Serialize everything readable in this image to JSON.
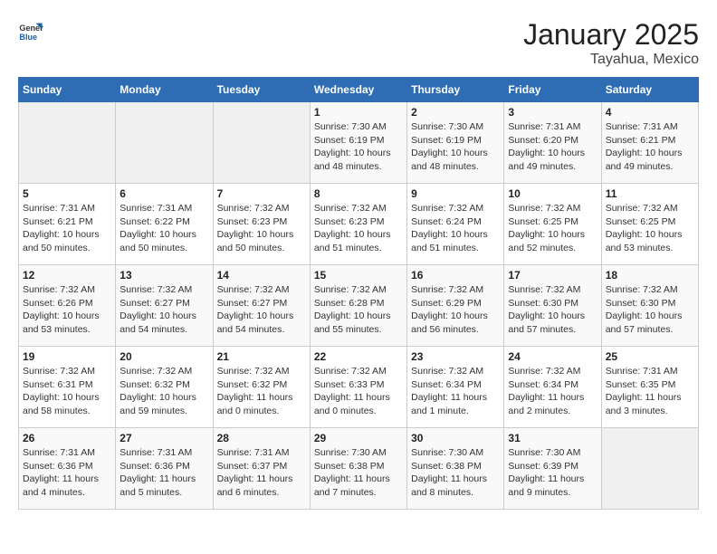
{
  "logo": {
    "text_general": "General",
    "text_blue": "Blue"
  },
  "title": "January 2025",
  "subtitle": "Tayahua, Mexico",
  "days_header": [
    "Sunday",
    "Monday",
    "Tuesday",
    "Wednesday",
    "Thursday",
    "Friday",
    "Saturday"
  ],
  "weeks": [
    [
      {
        "day": "",
        "info": ""
      },
      {
        "day": "",
        "info": ""
      },
      {
        "day": "",
        "info": ""
      },
      {
        "day": "1",
        "info": "Sunrise: 7:30 AM\nSunset: 6:19 PM\nDaylight: 10 hours\nand 48 minutes."
      },
      {
        "day": "2",
        "info": "Sunrise: 7:30 AM\nSunset: 6:19 PM\nDaylight: 10 hours\nand 48 minutes."
      },
      {
        "day": "3",
        "info": "Sunrise: 7:31 AM\nSunset: 6:20 PM\nDaylight: 10 hours\nand 49 minutes."
      },
      {
        "day": "4",
        "info": "Sunrise: 7:31 AM\nSunset: 6:21 PM\nDaylight: 10 hours\nand 49 minutes."
      }
    ],
    [
      {
        "day": "5",
        "info": "Sunrise: 7:31 AM\nSunset: 6:21 PM\nDaylight: 10 hours\nand 50 minutes."
      },
      {
        "day": "6",
        "info": "Sunrise: 7:31 AM\nSunset: 6:22 PM\nDaylight: 10 hours\nand 50 minutes."
      },
      {
        "day": "7",
        "info": "Sunrise: 7:32 AM\nSunset: 6:23 PM\nDaylight: 10 hours\nand 50 minutes."
      },
      {
        "day": "8",
        "info": "Sunrise: 7:32 AM\nSunset: 6:23 PM\nDaylight: 10 hours\nand 51 minutes."
      },
      {
        "day": "9",
        "info": "Sunrise: 7:32 AM\nSunset: 6:24 PM\nDaylight: 10 hours\nand 51 minutes."
      },
      {
        "day": "10",
        "info": "Sunrise: 7:32 AM\nSunset: 6:25 PM\nDaylight: 10 hours\nand 52 minutes."
      },
      {
        "day": "11",
        "info": "Sunrise: 7:32 AM\nSunset: 6:25 PM\nDaylight: 10 hours\nand 53 minutes."
      }
    ],
    [
      {
        "day": "12",
        "info": "Sunrise: 7:32 AM\nSunset: 6:26 PM\nDaylight: 10 hours\nand 53 minutes."
      },
      {
        "day": "13",
        "info": "Sunrise: 7:32 AM\nSunset: 6:27 PM\nDaylight: 10 hours\nand 54 minutes."
      },
      {
        "day": "14",
        "info": "Sunrise: 7:32 AM\nSunset: 6:27 PM\nDaylight: 10 hours\nand 54 minutes."
      },
      {
        "day": "15",
        "info": "Sunrise: 7:32 AM\nSunset: 6:28 PM\nDaylight: 10 hours\nand 55 minutes."
      },
      {
        "day": "16",
        "info": "Sunrise: 7:32 AM\nSunset: 6:29 PM\nDaylight: 10 hours\nand 56 minutes."
      },
      {
        "day": "17",
        "info": "Sunrise: 7:32 AM\nSunset: 6:30 PM\nDaylight: 10 hours\nand 57 minutes."
      },
      {
        "day": "18",
        "info": "Sunrise: 7:32 AM\nSunset: 6:30 PM\nDaylight: 10 hours\nand 57 minutes."
      }
    ],
    [
      {
        "day": "19",
        "info": "Sunrise: 7:32 AM\nSunset: 6:31 PM\nDaylight: 10 hours\nand 58 minutes."
      },
      {
        "day": "20",
        "info": "Sunrise: 7:32 AM\nSunset: 6:32 PM\nDaylight: 10 hours\nand 59 minutes."
      },
      {
        "day": "21",
        "info": "Sunrise: 7:32 AM\nSunset: 6:32 PM\nDaylight: 11 hours\nand 0 minutes."
      },
      {
        "day": "22",
        "info": "Sunrise: 7:32 AM\nSunset: 6:33 PM\nDaylight: 11 hours\nand 0 minutes."
      },
      {
        "day": "23",
        "info": "Sunrise: 7:32 AM\nSunset: 6:34 PM\nDaylight: 11 hours\nand 1 minute."
      },
      {
        "day": "24",
        "info": "Sunrise: 7:32 AM\nSunset: 6:34 PM\nDaylight: 11 hours\nand 2 minutes."
      },
      {
        "day": "25",
        "info": "Sunrise: 7:31 AM\nSunset: 6:35 PM\nDaylight: 11 hours\nand 3 minutes."
      }
    ],
    [
      {
        "day": "26",
        "info": "Sunrise: 7:31 AM\nSunset: 6:36 PM\nDaylight: 11 hours\nand 4 minutes."
      },
      {
        "day": "27",
        "info": "Sunrise: 7:31 AM\nSunset: 6:36 PM\nDaylight: 11 hours\nand 5 minutes."
      },
      {
        "day": "28",
        "info": "Sunrise: 7:31 AM\nSunset: 6:37 PM\nDaylight: 11 hours\nand 6 minutes."
      },
      {
        "day": "29",
        "info": "Sunrise: 7:30 AM\nSunset: 6:38 PM\nDaylight: 11 hours\nand 7 minutes."
      },
      {
        "day": "30",
        "info": "Sunrise: 7:30 AM\nSunset: 6:38 PM\nDaylight: 11 hours\nand 8 minutes."
      },
      {
        "day": "31",
        "info": "Sunrise: 7:30 AM\nSunset: 6:39 PM\nDaylight: 11 hours\nand 9 minutes."
      },
      {
        "day": "",
        "info": ""
      }
    ]
  ]
}
